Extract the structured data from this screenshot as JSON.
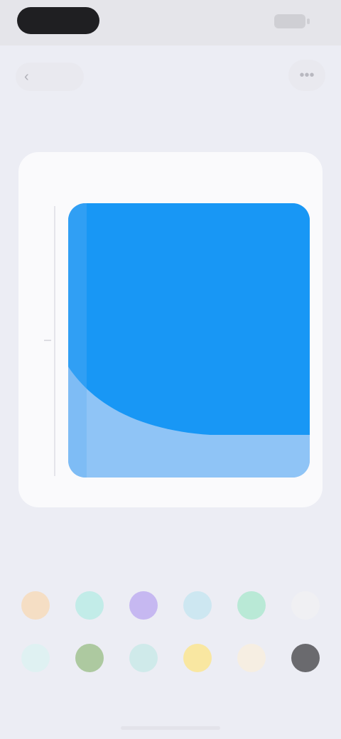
{
  "status_bar": {
    "time": "",
    "battery_icon": "battery-icon"
  },
  "nav": {
    "back_label": "",
    "back_icon": "chevron-left-icon",
    "title": "",
    "more_icon": "more-icon"
  },
  "preview": {
    "title": "",
    "fill_colors": {
      "main": "#1897f5",
      "light": "#8fc4f6",
      "edge": "#5eaef3"
    }
  },
  "palette": {
    "swatches": [
      {
        "name": "peach",
        "color": "#f5dec4"
      },
      {
        "name": "teal",
        "color": "#c2ece8"
      },
      {
        "name": "purple",
        "color": "#c6b8f1"
      },
      {
        "name": "sky",
        "color": "#cde7f1"
      },
      {
        "name": "mint",
        "color": "#b9e9d6"
      },
      {
        "name": "light-gray",
        "color": "#f0f0f3"
      },
      {
        "name": "ice",
        "color": "#dff1f2"
      },
      {
        "name": "olive",
        "color": "#adc9a0"
      },
      {
        "name": "aqua",
        "color": "#cfeaea"
      },
      {
        "name": "yellow",
        "color": "#f9e7a1"
      },
      {
        "name": "cream",
        "color": "#f6eee2"
      },
      {
        "name": "charcoal",
        "color": "#6a6a6e"
      }
    ]
  }
}
